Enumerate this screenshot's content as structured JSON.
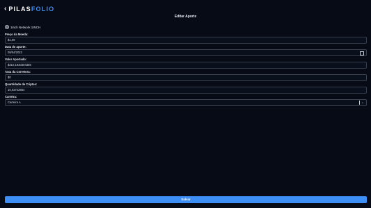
{
  "header": {
    "back_icon": "chevron-left-icon",
    "logo_part1": "PILAS",
    "logo_part2": "FOLIO",
    "title": "Editar Aporte"
  },
  "asset": {
    "icon": "coin-icon",
    "name": "1inch Network 1INCH"
  },
  "fields": {
    "price": {
      "label": "Preço da Moeda:",
      "value": "$1,09"
    },
    "date": {
      "label": "Data do aporte:",
      "value": "08/04/2022"
    },
    "invested": {
      "label": "Valor Aportado:",
      "value": "$310,1930304386"
    },
    "fee": {
      "label": "Taxa da Corretora:",
      "value": "$0"
    },
    "quantity": {
      "label": "Quantidade de Criptos:",
      "value": "10,03723664"
    },
    "wallet": {
      "label": "Carteira:",
      "value": "Carteira A"
    }
  },
  "save_label": "Salvar",
  "colors": {
    "background": "#070b16",
    "accent": "#3d8ef5",
    "border": "#3a4050"
  }
}
